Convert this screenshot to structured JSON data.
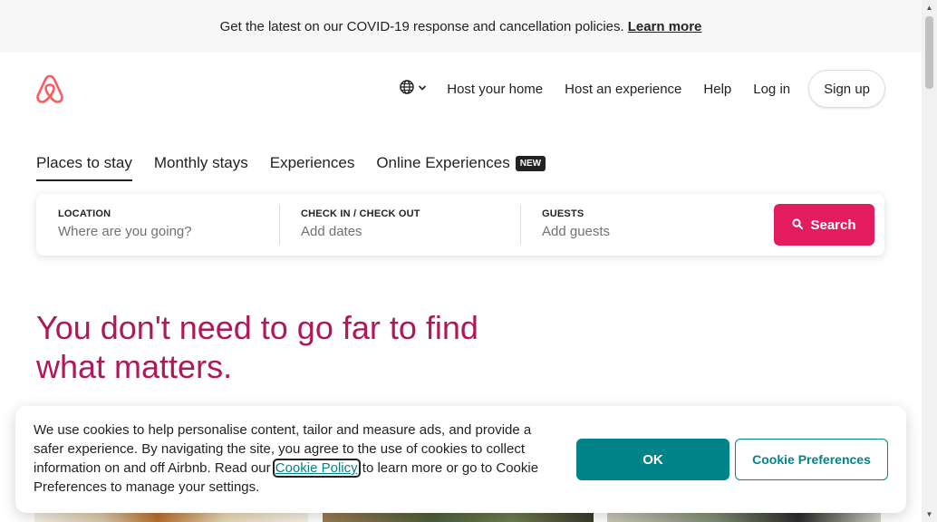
{
  "banner": {
    "message": "Get the latest on our COVID-19 response and cancellation policies.",
    "link": "Learn more"
  },
  "header": {
    "logo_icon": "airbnb-logo",
    "brand_color": "#ff5a5f",
    "nav": {
      "language_icon": "globe-icon",
      "host_home": "Host your home",
      "host_experience": "Host an experience",
      "help": "Help",
      "login": "Log in",
      "signup": "Sign up"
    }
  },
  "tabs": [
    {
      "label": "Places to stay",
      "active": true
    },
    {
      "label": "Monthly stays",
      "active": false
    },
    {
      "label": "Experiences",
      "active": false
    },
    {
      "label": "Online Experiences",
      "badge": "NEW",
      "active": false
    }
  ],
  "search": {
    "location": {
      "label": "LOCATION",
      "placeholder": "Where are you going?"
    },
    "dates": {
      "label": "CHECK IN / CHECK OUT",
      "placeholder": "Add dates"
    },
    "guests": {
      "label": "GUESTS",
      "placeholder": "Add guests"
    },
    "button": "Search",
    "button_color": "#e31c5f"
  },
  "hero": {
    "headline": "You don't need to go far to find what matters.",
    "color": "#b0185a"
  },
  "cookie_banner": {
    "text_before": "We use cookies to help personalise content, tailor and measure ads, and provide a safer experience. By navigating the site, you agree to the use of cookies to collect information on and off Airbnb. Read our",
    "link": "Cookie Policy",
    "text_after": "to learn more or go to Cookie Preferences to manage your settings.",
    "ok_button": "OK",
    "preferences_button": "Cookie Preferences",
    "accent_color": "#008489"
  }
}
